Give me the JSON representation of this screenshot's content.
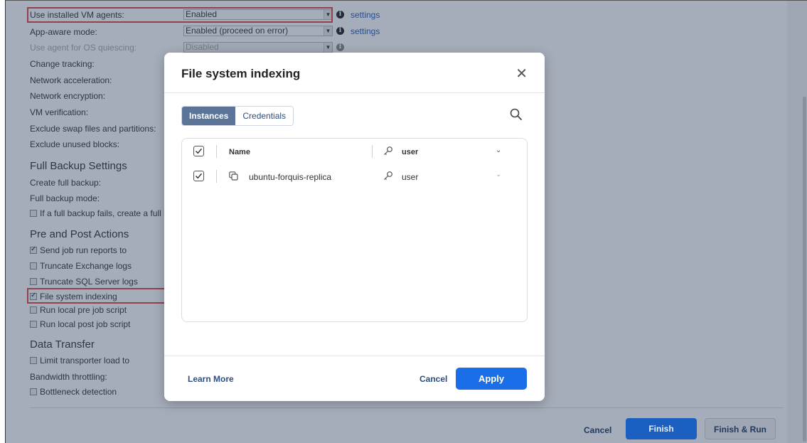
{
  "settings": {
    "rows": [
      {
        "label": "Use installed VM agents:",
        "value": "Enabled",
        "link": "settings"
      },
      {
        "label": "App-aware mode:",
        "value": "Enabled (proceed on error)",
        "link": "settings"
      },
      {
        "label": "Use agent for OS quiescing:",
        "value": "Disabled"
      },
      {
        "label": "Change tracking:"
      },
      {
        "label": "Network acceleration:"
      },
      {
        "label": "Network encryption:"
      },
      {
        "label": "VM verification:"
      },
      {
        "label": "Exclude swap files and partitions:"
      },
      {
        "label": "Exclude unused blocks:"
      }
    ],
    "full_backup": {
      "title": "Full Backup Settings",
      "create": "Create full backup:",
      "mode": "Full backup mode:",
      "fail_option": "If a full backup fails, create a full b"
    },
    "pre_post": {
      "title": "Pre and Post Actions",
      "items": [
        {
          "label": "Send job run reports to",
          "checked": true
        },
        {
          "label": "Truncate Exchange logs",
          "checked": false
        },
        {
          "label": "Truncate SQL Server logs",
          "checked": false
        },
        {
          "label": "File system indexing",
          "checked": true
        },
        {
          "label": "Run local pre job script",
          "checked": false
        },
        {
          "label": "Run local post job script",
          "checked": false
        }
      ]
    },
    "data_transfer": {
      "title": "Data Transfer",
      "limit": "Limit transporter load to",
      "bandwidth": "Bandwidth throttling:",
      "bottleneck": "Bottleneck detection"
    }
  },
  "footer": {
    "cancel": "Cancel",
    "finish": "Finish",
    "finish_run": "Finish & Run"
  },
  "modal": {
    "title": "File system indexing",
    "tabs": {
      "instances": "Instances",
      "credentials": "Credentials"
    },
    "grid": {
      "header": {
        "name": "Name",
        "user": "user"
      },
      "rows": [
        {
          "name": "ubuntu-forquis-replica",
          "user": "user",
          "checked": true
        }
      ]
    },
    "learn_more": "Learn More",
    "cancel": "Cancel",
    "apply": "Apply"
  },
  "colors": {
    "primary_button": "#1a6fe8",
    "tab_active": "#5b7497",
    "highlight": "#e0463f"
  }
}
